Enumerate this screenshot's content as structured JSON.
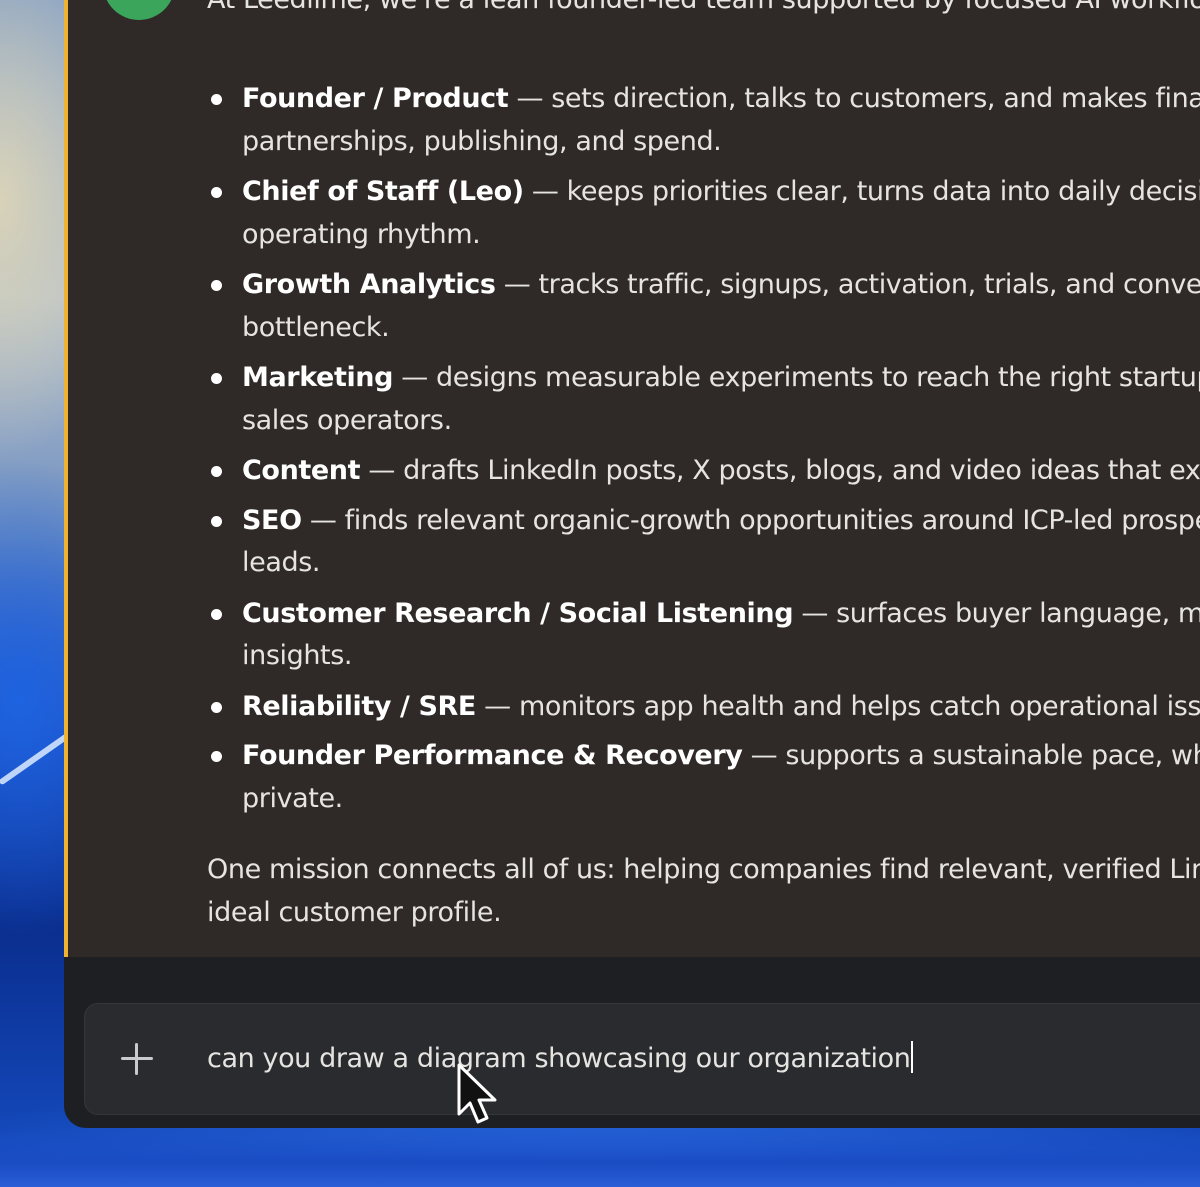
{
  "message": {
    "intro": "At Leedlime, we're a lean founder-led team supported by focused AI workflo",
    "roles": [
      {
        "title": "Founder / Product",
        "line1": " — sets direction, talks to customers, and makes final c",
        "line2": "partnerships, publishing, and spend."
      },
      {
        "title": "Chief of Staff (Leo)",
        "line1": " — keeps priorities clear, turns data into daily decision",
        "line2": "operating rhythm."
      },
      {
        "title": "Growth Analytics",
        "line1": " — tracks traffic, signups, activation, trials, and convers",
        "line2": "bottleneck."
      },
      {
        "title": "Marketing",
        "line1": " — designs measurable experiments to reach the right startup f",
        "line2": "sales operators."
      },
      {
        "title": "Content",
        "line1": " — drafts LinkedIn posts, X posts, blogs, and video ideas that expl",
        "line2": ""
      },
      {
        "title": "SEO",
        "line1": " — finds relevant organic-growth opportunities around ICP-led prospe",
        "line2": "leads."
      },
      {
        "title": "Customer Research / Social Listening",
        "line1": " — surfaces buyer language, marke",
        "line2": "insights."
      },
      {
        "title": "Reliability / SRE",
        "line1": " — monitors app health and helps catch operational issu",
        "line2": ""
      },
      {
        "title": "Founder Performance & Recovery",
        "line1": " — supports a sustainable pace, while k",
        "line2": "private."
      }
    ],
    "closing_line1": "One mission connects all of us: helping companies find relevant, verified Lin",
    "closing_line2": "ideal customer profile."
  },
  "composer": {
    "value": "can you draw a diagram showcasing our organization"
  },
  "colors": {
    "message_bg": "#2f2a27",
    "accent_border": "#f0b232",
    "avatar": "#3ba55c",
    "composer_bg": "#2a2b2f"
  },
  "icons": {
    "attach": "plus-icon",
    "cursor": "mouse-pointer-icon"
  }
}
